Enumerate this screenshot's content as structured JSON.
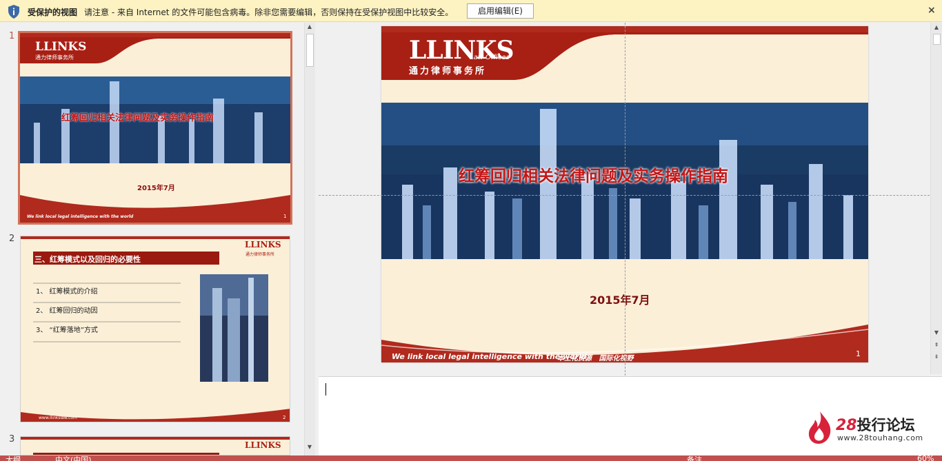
{
  "banner": {
    "title": "受保护的视图",
    "message": "请注意 - 来自 Internet 的文件可能包含病毒。除非您需要编辑，否则保持在受保护视图中比较安全。",
    "enable_edit_label": "启用编辑(E)",
    "close_symbol": "×"
  },
  "logo": {
    "brand": "LLINKS",
    "sub": "Law Offices",
    "cn": "通力律师事务所"
  },
  "slides": [
    {
      "number": "1",
      "title": "红筹回归相关法律问题及实务操作指南",
      "date": "2015年7月",
      "footer": "We link local legal intelligence with the world",
      "footer_cn": "本土化资源   国际化视野",
      "page": "1"
    },
    {
      "number": "2",
      "heading": "三、红筹模式以及回归的必要性",
      "items": [
        "1、 红筹模式的介绍",
        "2、 红筹回归的动因",
        "3、 “红筹落地”方式"
      ],
      "footer": "www.llinkslaw.com",
      "page": "2"
    },
    {
      "number": "3"
    }
  ],
  "watermark": {
    "num": "28",
    "text": "投行论坛",
    "url": "www.28touhang.com"
  },
  "status": {
    "left_a": "大纲",
    "lang": "中文(中国)",
    "notes": "备注",
    "zoom": "60%"
  },
  "colors": {
    "accent_red": "#c0504d",
    "banner_bg": "#fdf2c2",
    "slide_red": "#b61d1d"
  }
}
